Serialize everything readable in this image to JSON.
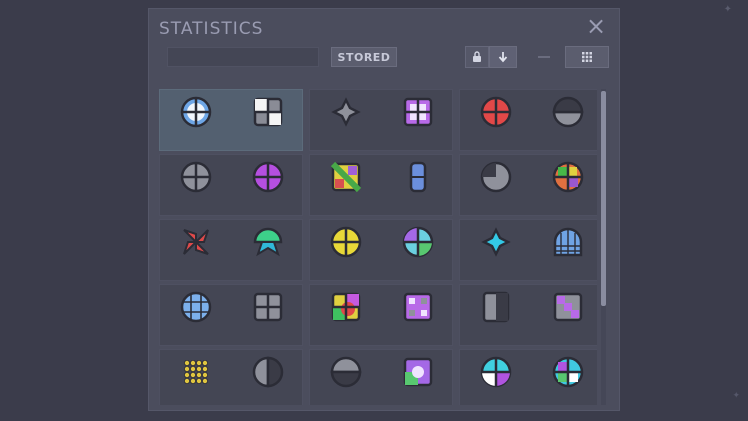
{
  "panel": {
    "title": "STATISTICS",
    "close_icon": "close-icon",
    "search": {
      "value": "",
      "placeholder": ""
    },
    "stored_button": "STORED",
    "toolbar_icons": [
      "lock-icon",
      "download-arrow-icon",
      "list-view-icon",
      "grid-view-icon"
    ],
    "subtitle": "",
    "scrollbar": {
      "position": 0.0,
      "visible_fraction": 0.68
    }
  },
  "rows": [
    {
      "cells": [
        {
          "selected": true,
          "items": [
            {
              "icon": "circle-cross-blue",
              "value": ""
            },
            {
              "icon": "quad-white-gray",
              "value": ""
            }
          ]
        },
        {
          "selected": false,
          "items": [
            {
              "icon": "star-gray",
              "value": ""
            },
            {
              "icon": "square-cross-purple",
              "value": ""
            }
          ]
        },
        {
          "selected": false,
          "items": [
            {
              "icon": "circle-cross-red",
              "value": ""
            },
            {
              "icon": "half-dark-gray",
              "value": ""
            }
          ]
        }
      ]
    },
    {
      "cells": [
        {
          "selected": false,
          "items": [
            {
              "icon": "circle-cross-gray",
              "value": ""
            },
            {
              "icon": "circle-cross-purple",
              "value": ""
            }
          ]
        },
        {
          "selected": false,
          "items": [
            {
              "icon": "mosaic-multicolor",
              "value": ""
            },
            {
              "icon": "capsule-blue",
              "value": ""
            }
          ]
        },
        {
          "selected": false,
          "items": [
            {
              "icon": "pie-gray",
              "value": ""
            },
            {
              "icon": "mosaic-circle-multicolor",
              "value": ""
            }
          ]
        }
      ]
    },
    {
      "cells": [
        {
          "selected": false,
          "items": [
            {
              "icon": "pinwheel-red",
              "value": ""
            },
            {
              "icon": "mushroom-green-cyan",
              "value": ""
            }
          ]
        },
        {
          "selected": false,
          "items": [
            {
              "icon": "circle-cross-yellow",
              "value": ""
            },
            {
              "icon": "swirl-purple-green",
              "value": ""
            }
          ]
        },
        {
          "selected": false,
          "items": [
            {
              "icon": "star-cyan",
              "value": ""
            },
            {
              "icon": "dome-grid-blue",
              "value": ""
            }
          ]
        }
      ]
    },
    {
      "cells": [
        {
          "selected": false,
          "items": [
            {
              "icon": "circle-grid-blue",
              "value": ""
            },
            {
              "icon": "quad-gray",
              "value": ""
            }
          ]
        },
        {
          "selected": false,
          "items": [
            {
              "icon": "quad-multicolor",
              "value": ""
            },
            {
              "icon": "pixel-purple",
              "value": ""
            }
          ]
        },
        {
          "selected": false,
          "items": [
            {
              "icon": "split-gray",
              "value": ""
            },
            {
              "icon": "pixel-purple-gray",
              "value": ""
            }
          ]
        }
      ]
    },
    {
      "cells": [
        {
          "selected": false,
          "items": [
            {
              "icon": "dots-yellow",
              "value": ""
            },
            {
              "icon": "half-circle-gray",
              "value": ""
            }
          ]
        },
        {
          "selected": false,
          "items": [
            {
              "icon": "half-dome-gray",
              "value": ""
            },
            {
              "icon": "swirl-purple-green-2",
              "value": ""
            }
          ]
        },
        {
          "selected": false,
          "items": [
            {
              "icon": "circle-split-cyan-purple",
              "value": ""
            },
            {
              "icon": "mosaic-circle-cyan",
              "value": ""
            }
          ]
        }
      ]
    }
  ]
}
